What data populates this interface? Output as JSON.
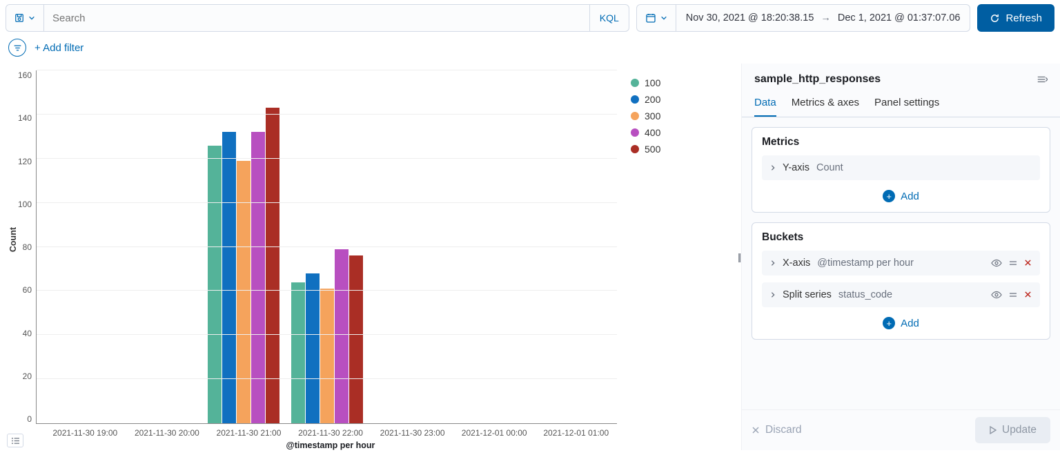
{
  "topbar": {
    "search_placeholder": "Search",
    "query_lang": "KQL",
    "time_from": "Nov 30, 2021 @ 18:20:38.15",
    "time_to": "Dec 1, 2021 @ 01:37:07.06",
    "refresh_label": "Refresh"
  },
  "filters": {
    "add_filter_label": "+ Add filter"
  },
  "chart_data": {
    "type": "bar",
    "title": "",
    "xlabel": "@timestamp per hour",
    "ylabel": "Count",
    "ylim": [
      0,
      160
    ],
    "y_ticks": [
      0,
      20,
      40,
      60,
      80,
      100,
      120,
      140,
      160
    ],
    "categories": [
      "2021-11-30 19:00",
      "2021-11-30 20:00",
      "2021-11-30 21:00",
      "2021-11-30 22:00",
      "2021-11-30 23:00",
      "2021-12-01 00:00",
      "2021-12-01 01:00"
    ],
    "series": [
      {
        "name": "100",
        "color": "#54b399",
        "values": [
          0,
          0,
          126,
          64,
          0,
          0,
          0
        ]
      },
      {
        "name": "200",
        "color": "#1070c0",
        "values": [
          0,
          0,
          132,
          68,
          0,
          0,
          0
        ]
      },
      {
        "name": "300",
        "color": "#f5a35c",
        "values": [
          0,
          0,
          119,
          61,
          0,
          0,
          0
        ]
      },
      {
        "name": "400",
        "color": "#b84fc0",
        "values": [
          0,
          0,
          132,
          79,
          0,
          0,
          0
        ]
      },
      {
        "name": "500",
        "color": "#aa2e25",
        "values": [
          0,
          0,
          143,
          76,
          0,
          0,
          0
        ]
      }
    ]
  },
  "panel": {
    "title": "sample_http_responses",
    "tabs": [
      "Data",
      "Metrics & axes",
      "Panel settings"
    ],
    "active_tab": 0,
    "metrics": {
      "title": "Metrics",
      "items": [
        {
          "label": "Y-axis",
          "detail": "Count"
        }
      ],
      "add_label": "Add"
    },
    "buckets": {
      "title": "Buckets",
      "items": [
        {
          "label": "X-axis",
          "detail": "@timestamp per hour"
        },
        {
          "label": "Split series",
          "detail": "status_code"
        }
      ],
      "add_label": "Add"
    },
    "discard_label": "Discard",
    "update_label": "Update"
  }
}
